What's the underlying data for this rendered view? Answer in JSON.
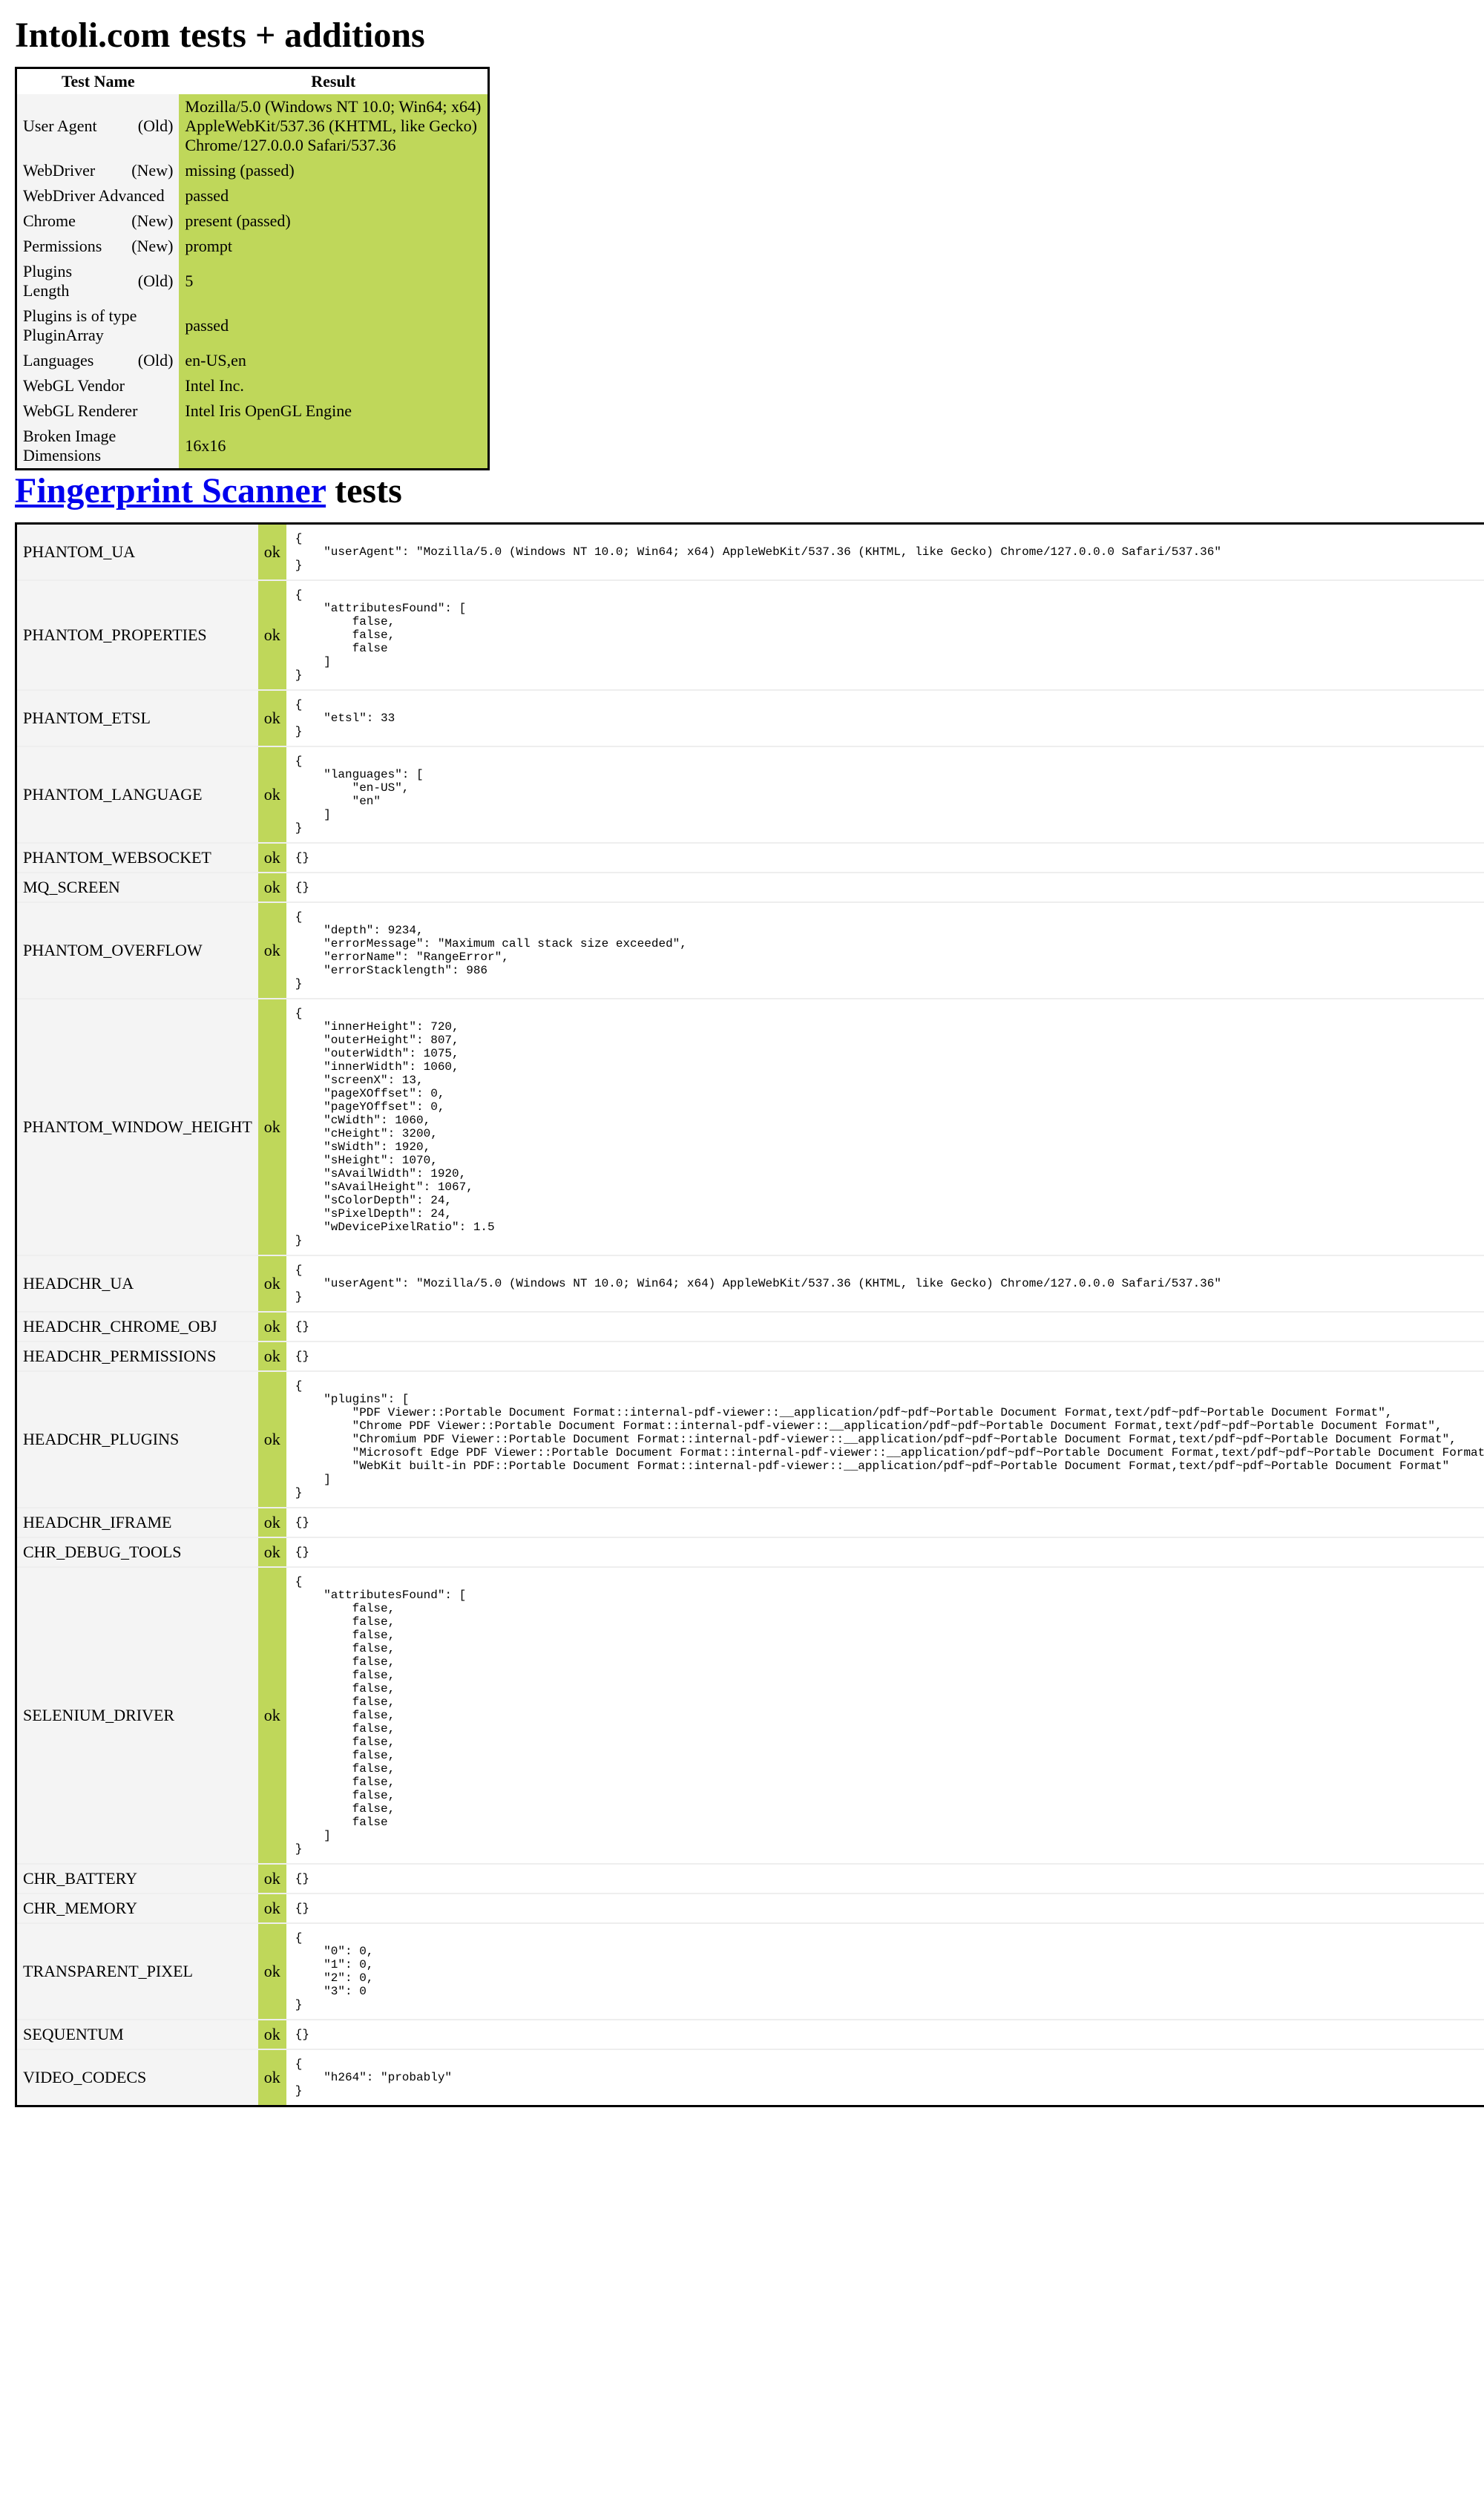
{
  "title1": "Intoli.com tests + additions",
  "title2_link": "Fingerprint Scanner",
  "title2_rest": " tests",
  "headers": {
    "testName": "Test Name",
    "result": "Result"
  },
  "intoli": [
    {
      "name": "User Agent",
      "tag": "(Old)",
      "result": "Mozilla/5.0 (Windows NT 10.0; Win64; x64) AppleWebKit/537.36 (KHTML, like Gecko) Chrome/127.0.0.0 Safari/537.36"
    },
    {
      "name": "WebDriver",
      "tag": "(New)",
      "result": "missing (passed)"
    },
    {
      "name": "WebDriver Advanced",
      "tag": "",
      "result": "passed"
    },
    {
      "name": "Chrome",
      "tag": "(New)",
      "result": "present (passed)"
    },
    {
      "name": "Permissions",
      "tag": "(New)",
      "result": "prompt"
    },
    {
      "name": "Plugins Length",
      "tag": "(Old)",
      "result": "5"
    },
    {
      "name": "Plugins is of type PluginArray",
      "tag": "",
      "result": "passed"
    },
    {
      "name": "Languages",
      "tag": "(Old)",
      "result": "en-US,en"
    },
    {
      "name": "WebGL Vendor",
      "tag": "",
      "result": "Intel Inc."
    },
    {
      "name": "WebGL Renderer",
      "tag": "",
      "result": "Intel Iris OpenGL Engine"
    },
    {
      "name": "Broken Image Dimensions",
      "tag": "",
      "result": "16x16"
    }
  ],
  "fp": [
    {
      "name": "PHANTOM_UA",
      "status": "ok",
      "data": "{\n    \"userAgent\": \"Mozilla/5.0 (Windows NT 10.0; Win64; x64) AppleWebKit/537.36 (KHTML, like Gecko) Chrome/127.0.0.0 Safari/537.36\"\n}"
    },
    {
      "name": "PHANTOM_PROPERTIES",
      "status": "ok",
      "data": "{\n    \"attributesFound\": [\n        false,\n        false,\n        false\n    ]\n}"
    },
    {
      "name": "PHANTOM_ETSL",
      "status": "ok",
      "data": "{\n    \"etsl\": 33\n}"
    },
    {
      "name": "PHANTOM_LANGUAGE",
      "status": "ok",
      "data": "{\n    \"languages\": [\n        \"en-US\",\n        \"en\"\n    ]\n}"
    },
    {
      "name": "PHANTOM_WEBSOCKET",
      "status": "ok",
      "data": "{}"
    },
    {
      "name": "MQ_SCREEN",
      "status": "ok",
      "data": "{}"
    },
    {
      "name": "PHANTOM_OVERFLOW",
      "status": "ok",
      "data": "{\n    \"depth\": 9234,\n    \"errorMessage\": \"Maximum call stack size exceeded\",\n    \"errorName\": \"RangeError\",\n    \"errorStacklength\": 986\n}"
    },
    {
      "name": "PHANTOM_WINDOW_HEIGHT",
      "status": "ok",
      "data": "{\n    \"innerHeight\": 720,\n    \"outerHeight\": 807,\n    \"outerWidth\": 1075,\n    \"innerWidth\": 1060,\n    \"screenX\": 13,\n    \"pageXOffset\": 0,\n    \"pageYOffset\": 0,\n    \"cWidth\": 1060,\n    \"cHeight\": 3200,\n    \"sWidth\": 1920,\n    \"sHeight\": 1070,\n    \"sAvailWidth\": 1920,\n    \"sAvailHeight\": 1067,\n    \"sColorDepth\": 24,\n    \"sPixelDepth\": 24,\n    \"wDevicePixelRatio\": 1.5\n}"
    },
    {
      "name": "HEADCHR_UA",
      "status": "ok",
      "data": "{\n    \"userAgent\": \"Mozilla/5.0 (Windows NT 10.0; Win64; x64) AppleWebKit/537.36 (KHTML, like Gecko) Chrome/127.0.0.0 Safari/537.36\"\n}"
    },
    {
      "name": "HEADCHR_CHROME_OBJ",
      "status": "ok",
      "data": "{}"
    },
    {
      "name": "HEADCHR_PERMISSIONS",
      "status": "ok",
      "data": "{}"
    },
    {
      "name": "HEADCHR_PLUGINS",
      "status": "ok",
      "data": "{\n    \"plugins\": [\n        \"PDF Viewer::Portable Document Format::internal-pdf-viewer::__application/pdf~pdf~Portable Document Format,text/pdf~pdf~Portable Document Format\",\n        \"Chrome PDF Viewer::Portable Document Format::internal-pdf-viewer::__application/pdf~pdf~Portable Document Format,text/pdf~pdf~Portable Document Format\",\n        \"Chromium PDF Viewer::Portable Document Format::internal-pdf-viewer::__application/pdf~pdf~Portable Document Format,text/pdf~pdf~Portable Document Format\",\n        \"Microsoft Edge PDF Viewer::Portable Document Format::internal-pdf-viewer::__application/pdf~pdf~Portable Document Format,text/pdf~pdf~Portable Document Format\",\n        \"WebKit built-in PDF::Portable Document Format::internal-pdf-viewer::__application/pdf~pdf~Portable Document Format,text/pdf~pdf~Portable Document Format\"\n    ]\n}"
    },
    {
      "name": "HEADCHR_IFRAME",
      "status": "ok",
      "data": "{}"
    },
    {
      "name": "CHR_DEBUG_TOOLS",
      "status": "ok",
      "data": "{}"
    },
    {
      "name": "SELENIUM_DRIVER",
      "status": "ok",
      "data": "{\n    \"attributesFound\": [\n        false,\n        false,\n        false,\n        false,\n        false,\n        false,\n        false,\n        false,\n        false,\n        false,\n        false,\n        false,\n        false,\n        false,\n        false,\n        false,\n        false\n    ]\n}"
    },
    {
      "name": "CHR_BATTERY",
      "status": "ok",
      "data": "{}"
    },
    {
      "name": "CHR_MEMORY",
      "status": "ok",
      "data": "{}"
    },
    {
      "name": "TRANSPARENT_PIXEL",
      "status": "ok",
      "data": "{\n    \"0\": 0,\n    \"1\": 0,\n    \"2\": 0,\n    \"3\": 0\n}"
    },
    {
      "name": "SEQUENTUM",
      "status": "ok",
      "data": "{}"
    },
    {
      "name": "VIDEO_CODECS",
      "status": "ok",
      "data": "{\n    \"h264\": \"probably\"\n}"
    }
  ]
}
